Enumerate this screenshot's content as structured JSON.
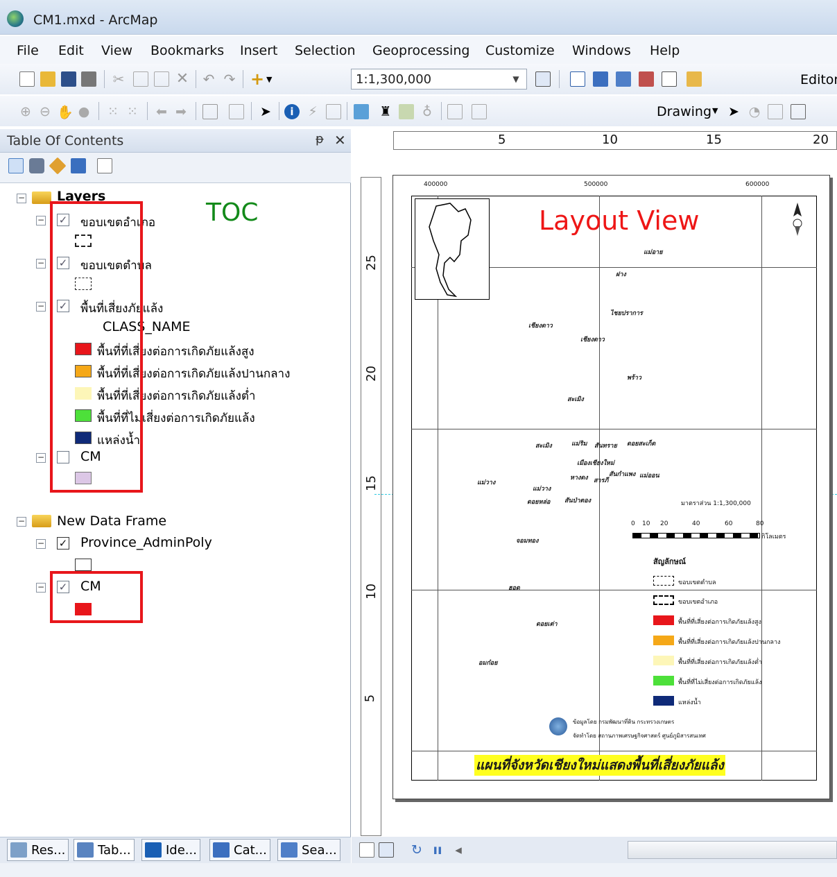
{
  "window": {
    "title": "CM1.mxd - ArcMap"
  },
  "menu": [
    "File",
    "Edit",
    "View",
    "Bookmarks",
    "Insert",
    "Selection",
    "Geoprocessing",
    "Customize",
    "Windows",
    "Help"
  ],
  "toolbar": {
    "scale_value": "1:1,300,000",
    "editor_label": "Editor",
    "drawing_label": "Drawing"
  },
  "toc": {
    "title": "Table Of Contents",
    "annotation": "TOC",
    "layers_group": "Layers",
    "layer_amphoe": "ขอบเขตอำเภอ",
    "layer_tambon": "ขอบเขตตำบล",
    "layer_drought": "พื้นที่เสี่ยงภัยแล้ง",
    "class_name": "CLASS_NAME",
    "class_items": [
      {
        "label": "พื้นที่ที่เสี่ยงต่อการเกิดภัยแล้งสูง",
        "color": "#e8161b"
      },
      {
        "label": "พื้นที่ที่เสี่ยงต่อการเกิดภัยแล้งปานกลาง",
        "color": "#f5a818"
      },
      {
        "label": "พื้นที่ที่เสี่ยงต่อการเกิดภัยแล้งต่ำ",
        "color": "#fdf6b8"
      },
      {
        "label": "พื้นที่ที่ไม่เสี่ยงต่อการเกิดภัยแล้ง",
        "color": "#4de03a"
      },
      {
        "label": "แหล่งน้ำ",
        "color": "#0f2a78"
      }
    ],
    "layer_cm": "CM",
    "cm_color": "#dcc7e6",
    "data_frame": "New Data Frame",
    "province_layer": "Province_AdminPoly",
    "cm2_layer": "CM",
    "cm2_color": "#e8161b"
  },
  "bottom_tabs": [
    "Res...",
    "Tab...",
    "Ide...",
    "Cat...",
    "Sea..."
  ],
  "layout": {
    "annotation": "Layout View",
    "hruler": [
      "5",
      "10",
      "15",
      "20"
    ],
    "vruler": [
      "25",
      "20",
      "15",
      "10",
      "5"
    ],
    "map_title": "แผนที่จังหวัดเชียงใหม่แสดงพื้นที่เสี่ยงภัยแล้ง",
    "scale_text": "มาตราส่วน 1:1,300,000",
    "scalebar_ticks": [
      "0",
      "10",
      "20",
      "40",
      "60",
      "80"
    ],
    "scalebar_unit": "กิโลเมตร",
    "legend_title": "สัญลักษณ์",
    "legend_items": [
      "ขอบเขตตำบล",
      "ขอบเขตอำเภอ",
      "พื้นที่ที่เสี่ยงต่อการเกิดภัยแล้งสูง",
      "พื้นที่ที่เสี่ยงต่อการเกิดภัยแล้งปานกลาง",
      "พื้นที่ที่เสี่ยงต่อการเกิดภัยแล้งต่ำ",
      "พื้นที่ที่ไม่เสี่ยงต่อการเกิดภัยแล้ง",
      "แหล่งน้ำ"
    ],
    "source_line1": "ข้อมูลโดย กรมพัฒนาที่ดิน กระทรวงเกษตร",
    "source_line2": "จัดทำโดย สถานภาพเศรษฐกิจศาสตร์ ศูนย์ภูมิสารสนเทศ",
    "coords_top": [
      "400000",
      "500000",
      "600000"
    ],
    "places": [
      "แม่อาย",
      "ฝาง",
      "ไชยปราการ",
      "เชียงดาว",
      "พร้าว",
      "สะเมิง",
      "แม่แตง",
      "แม่ริม",
      "สันทราย",
      "ดอยสะเก็ด",
      "เมืองเชียงใหม่",
      "หางดง",
      "สารภี",
      "สันกำแพง",
      "แม่ออน",
      "แม่วาง",
      "ดอยหล่อ",
      "สันป่าตอง",
      "จอมทอง",
      "ฮอด",
      "ดอยเต่า",
      "อมก๋อย"
    ]
  }
}
